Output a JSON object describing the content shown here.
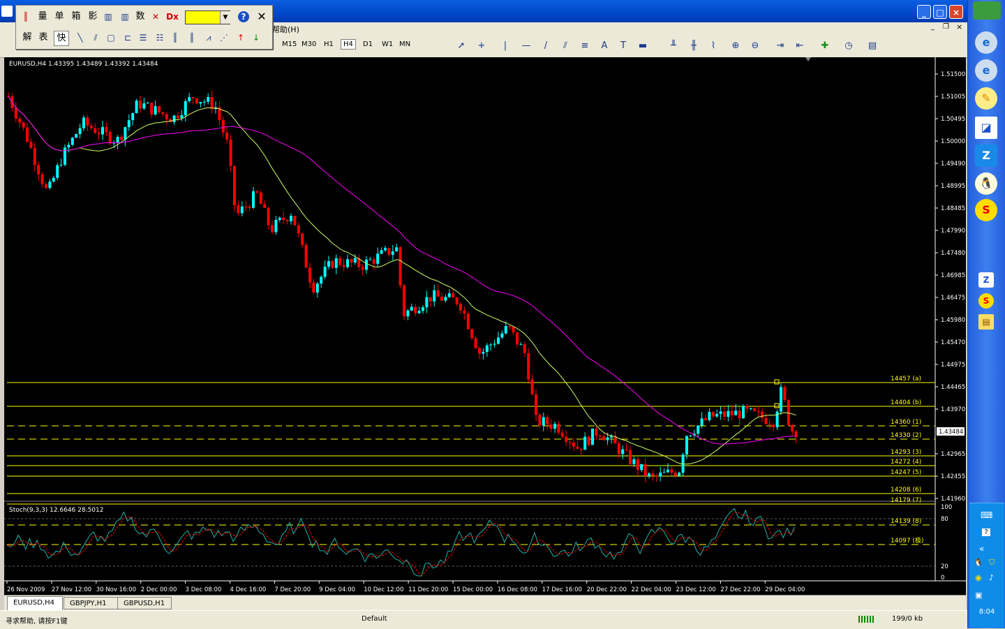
{
  "menu": {
    "help": "帮助(H)"
  },
  "floatbar": {
    "row1": [
      "量",
      "单",
      "箱",
      "影",
      "数"
    ],
    "row2": [
      "解",
      "表",
      "快"
    ]
  },
  "timeframes": [
    "M15",
    "M30",
    "H1",
    "H4",
    "D1",
    "W1",
    "MN"
  ],
  "chart": {
    "header": "EURUSD,H4  1.43395 1.43489 1.43392 1.43484",
    "stoch_label": "Stoch(9,3,3) 12.6646 28.5012",
    "current_price": "1.43484",
    "price_ticks": [
      "1.51500",
      "1.51005",
      "1.50495",
      "1.50000",
      "1.49490",
      "1.48995",
      "1.48485",
      "1.47990",
      "1.47480",
      "1.46985",
      "1.46475",
      "1.45980",
      "1.45470",
      "1.44975",
      "1.44465",
      "1.43970",
      "1.43484",
      "1.42965",
      "1.42455",
      "1.41960"
    ],
    "stoch_ticks": [
      "100",
      "80",
      "20",
      "0"
    ],
    "time_ticks": [
      "26 Nov 2009",
      "27 Nov 12:00",
      "30 Nov 16:00",
      "2 Dec 00:00",
      "3 Dec 08:00",
      "4 Dec 16:00",
      "7 Dec 20:00",
      "9 Dec 04:00",
      "10 Dec 12:00",
      "11 Dec 20:00",
      "15 Dec 00:00",
      "16 Dec 08:00",
      "17 Dec 16:00",
      "20 Dec 22:00",
      "22 Dec 04:00",
      "23 Dec 12:00",
      "27 Dec 22:00",
      "29 Dec 04:00"
    ],
    "levels": [
      {
        "label": "14457 (a)",
        "style": "solid"
      },
      {
        "label": "14404 (b)",
        "style": "solid"
      },
      {
        "label": "14360 (1)",
        "style": "dash"
      },
      {
        "label": "14330 (2)",
        "style": "dash"
      },
      {
        "label": "14293 (3)",
        "style": "solid"
      },
      {
        "label": "14272 (4)",
        "style": "solid"
      },
      {
        "label": "14247 (5)",
        "style": "solid"
      },
      {
        "label": "14208 (6)",
        "style": "solid"
      },
      {
        "label": "14179 (7)",
        "style": "solid"
      },
      {
        "label": "14139 (8)",
        "style": "dash"
      },
      {
        "label": "14097 (极)",
        "style": "dash"
      }
    ]
  },
  "tabs": [
    "EURUSD,H4",
    "GBPJPY,H1",
    "GBPUSD,H1"
  ],
  "status": {
    "help": "寻求帮助, 请按F1键",
    "profile": "Default",
    "traffic": "199/0 kb"
  },
  "clock": "8:04",
  "colors": {
    "bull": "#00ffff",
    "bear": "#ff0000",
    "ma_fast": "#ccff66",
    "ma_slow": "#ff00ff",
    "level": "#ffff00"
  }
}
